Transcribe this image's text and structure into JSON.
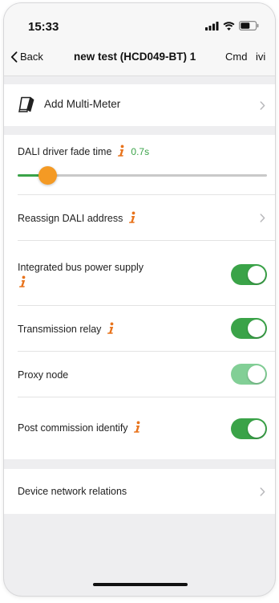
{
  "status_bar": {
    "time": "15:33"
  },
  "nav": {
    "back_label": "Back",
    "title": "new test (HCD049-BT) 1",
    "cmd_label": "Cmd",
    "ivi_label": "ivi"
  },
  "multimeter": {
    "label": "Add Multi-Meter"
  },
  "settings": {
    "fade": {
      "label": "DALI driver fade time",
      "value": "0.7s",
      "slider_level": 0.12
    },
    "reassign": {
      "label": "Reassign DALI address"
    },
    "bus_power": {
      "label": "Integrated bus power supply",
      "on": true
    },
    "relay": {
      "label": "Transmission relay",
      "on": true
    },
    "proxy": {
      "label": "Proxy node",
      "on": true
    },
    "post_identify": {
      "label": "Post commission identify",
      "on": true
    }
  },
  "relations": {
    "label": "Device network relations"
  },
  "colors": {
    "accent_green": "#3aa348",
    "dim_green": "#82cf96",
    "info_orange": "#e8731c",
    "slider_thumb": "#f49a24"
  },
  "icons": [
    "signal-icon",
    "wifi-icon",
    "battery-icon",
    "back-chevron-icon",
    "multimeter-icon",
    "info-icon",
    "chevron-right-icon"
  ]
}
